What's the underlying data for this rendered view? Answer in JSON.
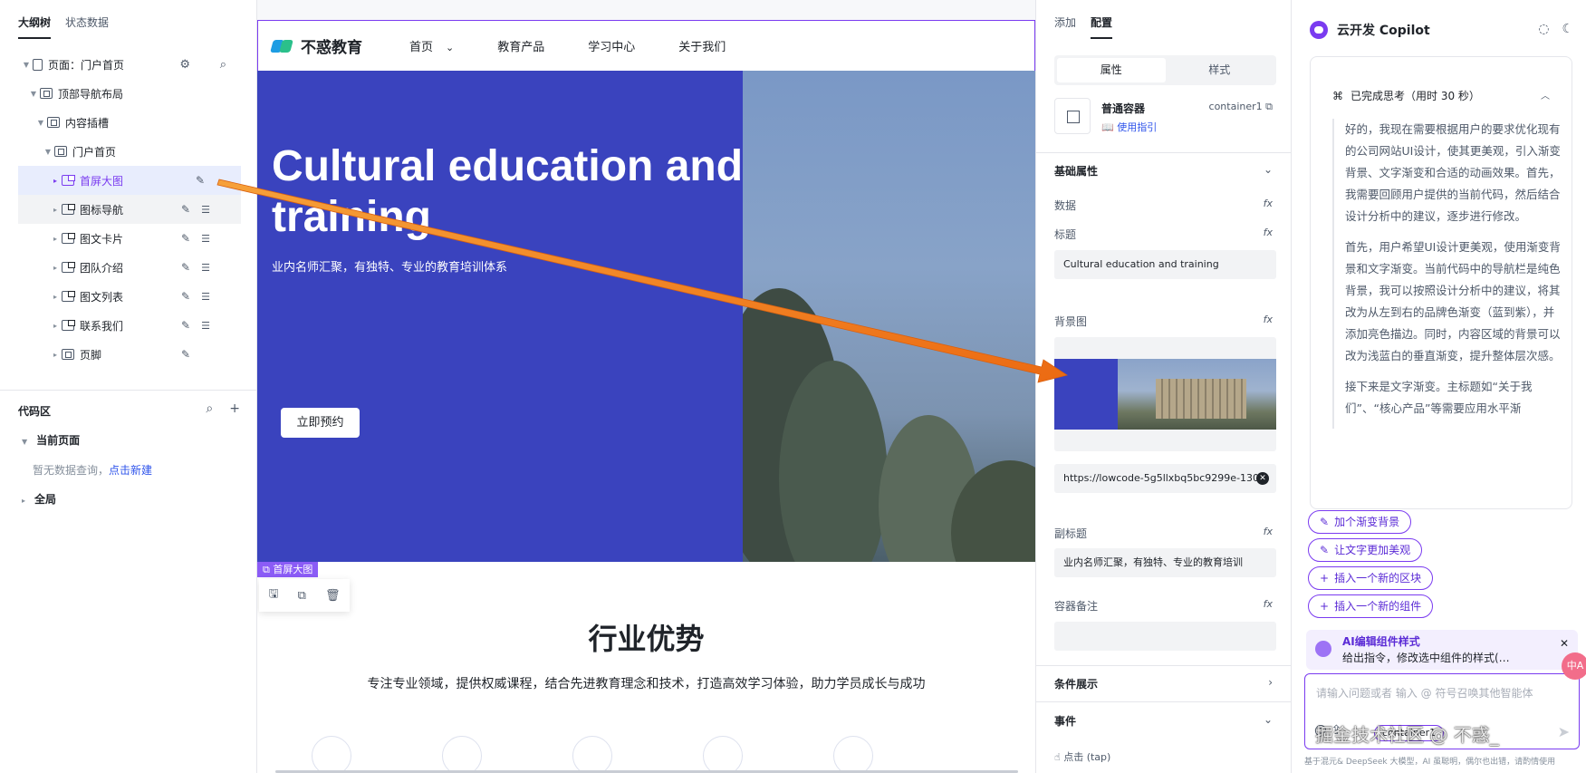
{
  "left_panel": {
    "tabs": [
      "大纲树",
      "状态数据"
    ],
    "tree": [
      {
        "label": "页面：门户首页",
        "level": 0
      },
      {
        "label": "顶部导航布局",
        "level": 1
      },
      {
        "label": "内容插槽",
        "level": 2
      },
      {
        "label": "门户首页",
        "level": 3
      },
      {
        "label": "首屏大图",
        "level": 4,
        "selected": true
      },
      {
        "label": "图标导航",
        "level": 4
      },
      {
        "label": "图文卡片",
        "level": 4
      },
      {
        "label": "团队介绍",
        "level": 4
      },
      {
        "label": "图文列表",
        "level": 4
      },
      {
        "label": "联系我们",
        "level": 4
      },
      {
        "label": "页脚",
        "level": 4
      }
    ],
    "code_area": {
      "title": "代码区",
      "current_page": "当前页面",
      "empty_text": "暂无数据查询，",
      "create_link": "点击新建",
      "global": "全局"
    }
  },
  "canvas": {
    "logo_text": "不惑教育",
    "nav_items": [
      "首页",
      "教育产品",
      "学习中心",
      "关于我们"
    ],
    "hero_title": "Cultural education and training",
    "hero_subtitle": "业内名师汇聚，有独特、专业的教育培训体系",
    "hero_button": "立即预约",
    "selected_tag": "首屏大图",
    "section_title": "行业优势",
    "section_desc": "专注专业领域，提供权威课程，结合先进教育理念和技术，打造高效学习体验，助力学员成长与成功"
  },
  "config": {
    "tabs": [
      "添加",
      "配置"
    ],
    "segments": [
      "属性",
      "样式"
    ],
    "component_name": "普通容器",
    "component_id": "container1",
    "guide_link": "使用指引",
    "basic_section": "基础属性",
    "field_data": "数据",
    "field_title": "标题",
    "title_value": "Cultural education and training",
    "field_bg": "背景图",
    "bg_url": "https://lowcode-5g5llxbq5bc9299e-130",
    "field_subtitle": "副标题",
    "subtitle_value": "业内名师汇聚，有独特、专业的教育培训",
    "field_note": "容器备注",
    "cond_section": "条件展示",
    "event_section": "事件",
    "event_tap": "点击 (tap)"
  },
  "copilot": {
    "title": "云开发 Copilot",
    "think_status": "已完成思考（用时 30 秒）",
    "think_paragraphs": [
      "好的，我现在需要根据用户的要求优化现有的公司网站UI设计，使其更美观，引入渐变背景、文字渐变和合适的动画效果。首先，我需要回顾用户提供的当前代码，然后结合设计分析中的建议，逐步进行修改。",
      "首先，用户希望UI设计更美观，使用渐变背景和文字渐变。当前代码中的导航栏是纯色背景，我可以按照设计分析中的建议，将其改为从左到右的品牌色渐变（蓝到紫），并添加亮色描边。同时，内容区域的背景可以改为浅蓝白的垂直渐变，提升整体层次感。",
      "接下来是文字渐变。主标题如“关于我们”、“核心产品”等需要应用水平渐"
    ],
    "chips": [
      "加个渐变背景",
      "让文字更加美观",
      "插入一个新的区块",
      "插入一个新的组件"
    ],
    "ai_card_title": "AI编辑组件样式",
    "ai_card_desc": "给出指令，修改选中组件的样式(…",
    "input_placeholder": "请输入问题或者 输入 @ 符号召唤其他智能体",
    "input_tag": "container1",
    "disclaimer": "基于混元& DeepSeek 大模型，AI 虽聪明，偶尔也出错，请酌情使用",
    "badge": "中A"
  },
  "watermark": "掘金技术社区 @ 不惑_",
  "colors": {
    "accent": "#7a3bf0",
    "hero_blue": "#3a43be",
    "arrow": "#f07d1a"
  }
}
